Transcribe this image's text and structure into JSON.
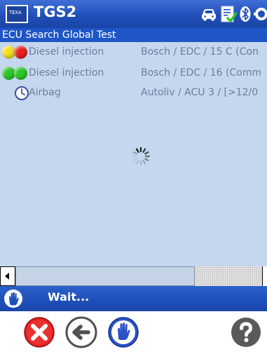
{
  "app": {
    "title": "TGS2",
    "logo_text": "TEXA"
  },
  "status_icons": [
    "car-icon",
    "checklist-icon",
    "bluetooth-icon",
    "connection-icon"
  ],
  "subtitle": "ECU Search Global Test",
  "list": {
    "rows": [
      {
        "lights": [
          "yellow",
          "red"
        ],
        "name": "Diesel injection",
        "detail": "Bosch / EDC / 15 C (Con"
      },
      {
        "lights": [
          "green",
          "green"
        ],
        "name": "Diesel injection",
        "detail": "Bosch / EDC / 16 (Comm"
      },
      {
        "status": "clock",
        "name": "Airbag",
        "detail": "Autoliv / ACU 3 / [>12/0"
      }
    ]
  },
  "colors": {
    "yellow": "#f2e020",
    "red": "#e8231f",
    "green": "#2ec82a",
    "list_bg": "#c4d7ee",
    "title_bg": "#1f4fb8"
  },
  "statusbar": {
    "text": "Wait..."
  },
  "toolbar": {
    "buttons": [
      "cancel-button",
      "back-button",
      "stop-button",
      "help-button"
    ]
  }
}
